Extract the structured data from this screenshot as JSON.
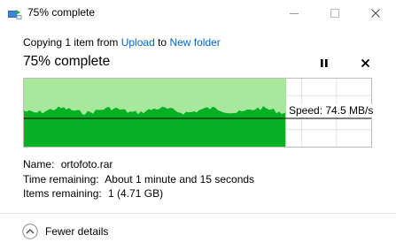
{
  "window": {
    "title": "75% complete",
    "icon": "file-copy-icon",
    "controls": [
      "minimize",
      "maximize",
      "close"
    ]
  },
  "operation": {
    "prefix": "Copying 1 item from ",
    "source": "Upload",
    "middle": " to ",
    "destination": "New folder"
  },
  "progress": {
    "heading": "75% complete",
    "fraction": 0.75,
    "speed_label": "Speed: 74.5 MB/s"
  },
  "details": {
    "name_label": "Name:",
    "name_value": "ortofoto.rar",
    "time_label": "Time remaining:",
    "time_value": "About 1 minute and 15 seconds",
    "items_label": "Items remaining:",
    "items_value": "1 (4.71 GB)"
  },
  "footer": {
    "toggle_label": "Fewer details"
  },
  "colors": {
    "progress_fill": "#a8e89c",
    "throughput_fill": "#06b025",
    "link": "#0066cc"
  }
}
